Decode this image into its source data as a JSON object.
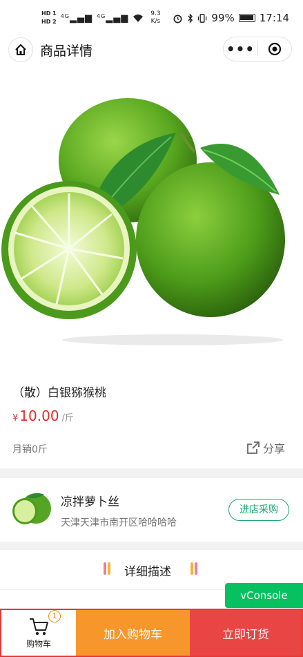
{
  "status_bar": {
    "hd_top": "HD 1",
    "hd_bottom": "HD 2",
    "signal1": "4G",
    "signal2": "4G",
    "speed_value": "9.3",
    "speed_unit": "K/s",
    "battery_percent": "99%",
    "time": "17:14"
  },
  "nav": {
    "title": "商品详情",
    "more_icon": "•••"
  },
  "product": {
    "name": "（散）白银猕猴桃",
    "currency": "¥",
    "price": "10.00",
    "unit": "/斤",
    "sales": "月销0斤",
    "share_label": "分享",
    "image": "lime-product-photo"
  },
  "shop": {
    "name": "凉拌萝卜丝",
    "address": "天津天津市南开区哈哈哈哈",
    "enter_label": "进店采购"
  },
  "detail": {
    "title": "详细描述"
  },
  "vconsole": {
    "label": "vConsole"
  },
  "bottom_bar": {
    "cart_label": "购物车",
    "cart_count": "1",
    "add_to_cart": "加入购物车",
    "order_now": "立即订货"
  },
  "colors": {
    "price_red": "#e02b2b",
    "accent_green": "#1aa56b",
    "vconsole_green": "#07c160",
    "add_cart_orange": "#f7962a",
    "order_red": "#e94544",
    "highlight_border": "#e53935"
  }
}
